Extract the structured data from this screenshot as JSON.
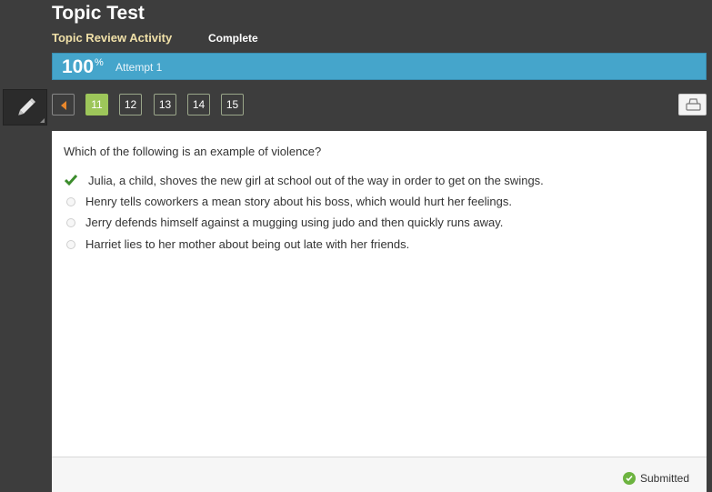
{
  "header": {
    "title": "Topic Test",
    "activity": "Topic Review Activity",
    "status": "Complete"
  },
  "progress": {
    "percent_value": 100,
    "percent_label": "100",
    "percent_sign": "%",
    "attempt": "Attempt 1",
    "bar_color": "#45a5cb"
  },
  "toolbar": {
    "pencil_icon": "pencil-icon",
    "print_icon": "printer-icon"
  },
  "pagination": {
    "prev_icon": "triangle-left-icon",
    "pages": [
      "11",
      "12",
      "13",
      "14",
      "15"
    ],
    "current": "11",
    "active_color": "#9dc65a"
  },
  "question": {
    "text": "Which of the following is an example of violence?",
    "options": [
      {
        "text": "Julia, a child, shoves the new girl at school out of the way in order to get on the swings.",
        "state": "correct-selected"
      },
      {
        "text": "Henry tells coworkers a mean story about his boss, which would hurt her feelings.",
        "state": "unselected"
      },
      {
        "text": "Jerry defends himself against a mugging using judo and then quickly runs away.",
        "state": "unselected"
      },
      {
        "text": "Harriet lies to her mother about being out late with her friends.",
        "state": "unselected"
      }
    ]
  },
  "footer": {
    "status": "Submitted",
    "status_icon": "check-circle-icon",
    "status_color": "#6cb33f"
  }
}
